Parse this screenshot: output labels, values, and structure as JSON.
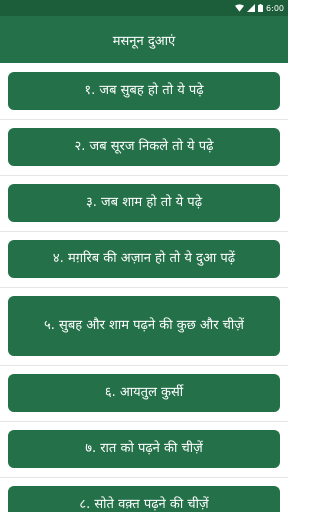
{
  "status_bar": {
    "time": "6:00",
    "icons": [
      "wifi-icon",
      "signal-icon",
      "battery-icon"
    ]
  },
  "app_bar": {
    "title": "मसनून दुआएं"
  },
  "list": {
    "items": [
      {
        "label": "१. जब सुबह हो तो ये पढ़े"
      },
      {
        "label": "२. जब सूरज निकले तो ये पढ़े"
      },
      {
        "label": "३. जब शाम हो तो ये पढ़े"
      },
      {
        "label": "४. मग़रिब की अज़ान हो तो ये दुआ पढ़ें"
      },
      {
        "label": "५. सुबह और शाम पढ़ने की कुछ और चीज़ें"
      },
      {
        "label": "६. आयतुल कुर्सी"
      },
      {
        "label": "७. रात को पढ़ने की चीज़ें"
      },
      {
        "label": "८. सोते वक़्त पढ़ने की चीज़ें"
      }
    ]
  },
  "colors": {
    "status_bar": "#1d5e3a",
    "primary": "#237049",
    "text_on_primary": "#ffffff",
    "background": "#ffffff",
    "divider": "#e6e6e6"
  }
}
